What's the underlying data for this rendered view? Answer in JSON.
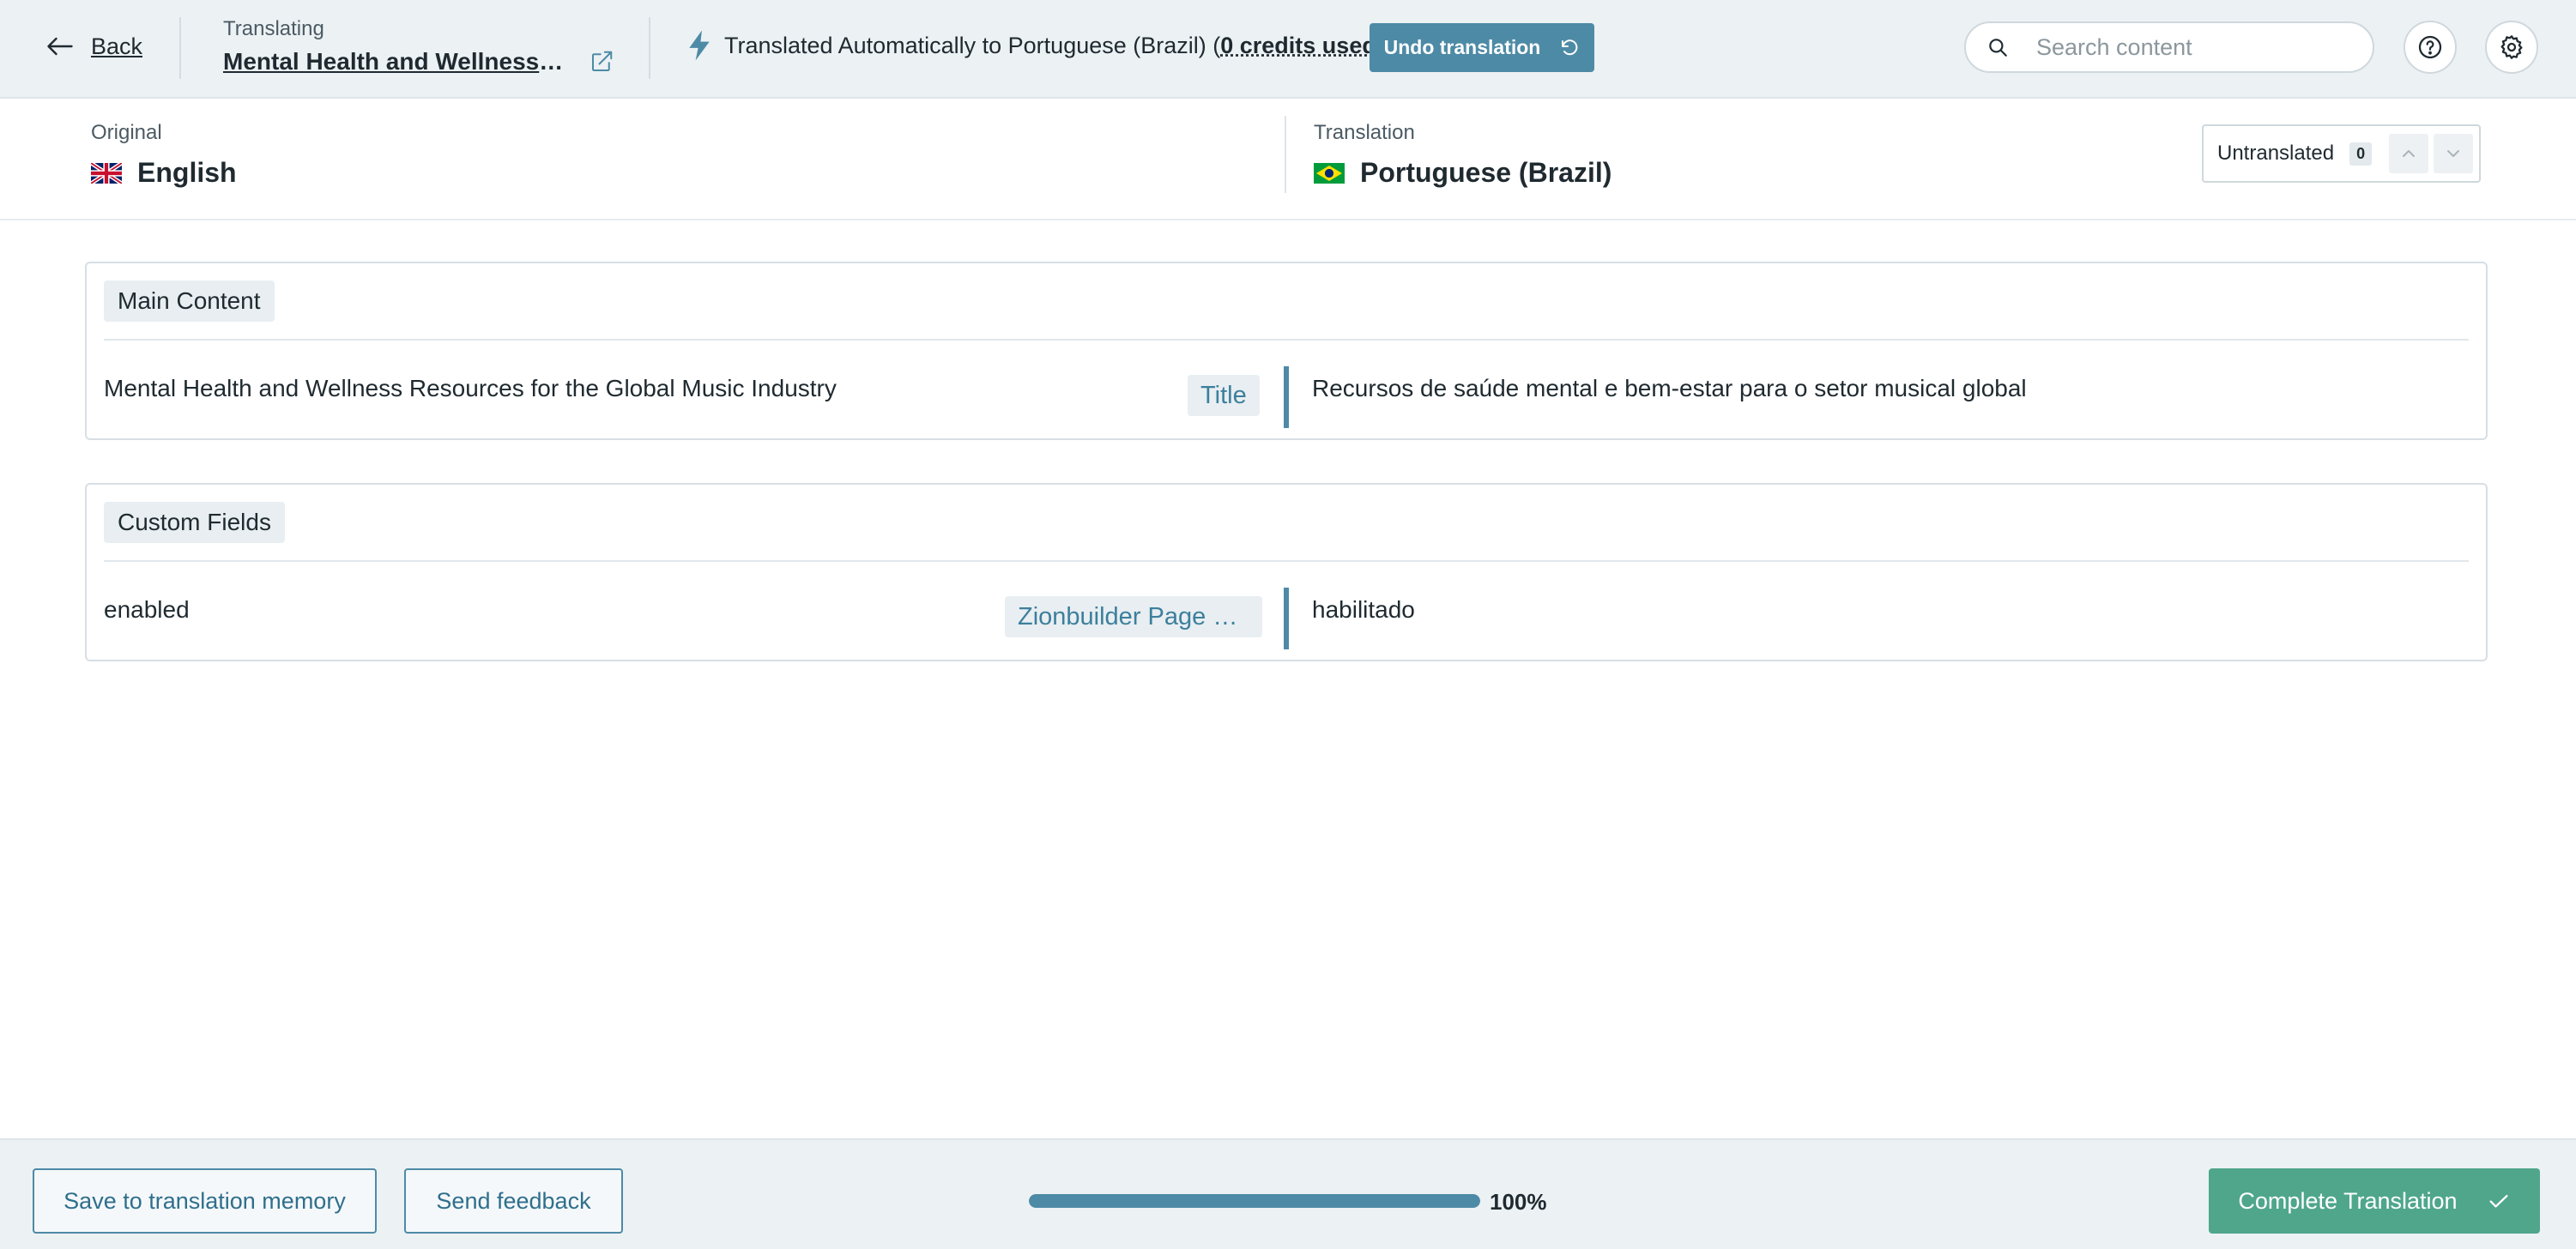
{
  "header": {
    "back_label": "Back",
    "translating_label": "Translating",
    "document_title": "Mental Health and Wellness Resources for the Global Music Industry",
    "auto_note_prefix": "Translated Automatically to Portuguese (Brazil) (",
    "credits_label": "0 credits used",
    "auto_note_suffix": ")",
    "undo_label": "Undo translation",
    "search_placeholder": "Search content",
    "icons": {
      "back": "arrow-left-icon",
      "external": "external-link-icon",
      "auto": "lightning-bolt-icon",
      "undo": "undo-icon",
      "search": "search-icon",
      "help": "help-circle-icon",
      "settings": "gear-icon"
    }
  },
  "languages": {
    "original_label": "Original",
    "original_name": "English",
    "original_flag": "uk-flag-icon",
    "translation_label": "Translation",
    "translation_name": "Portuguese (Brazil)",
    "translation_flag": "brazil-flag-icon",
    "untranslated_label": "Untranslated",
    "untranslated_count": "0"
  },
  "sections": [
    {
      "title": "Main Content",
      "rows": [
        {
          "original": "Mental Health and Wellness Resources for the Global Music Industry",
          "type": "Title",
          "translation": "Recursos de saúde mental e bem-estar para o setor musical global"
        }
      ]
    },
    {
      "title": "Custom Fields",
      "rows": [
        {
          "original": "enabled",
          "type": "Zionbuilder Page Status",
          "translation": "habilitado"
        }
      ]
    }
  ],
  "footer": {
    "save_memory_label": "Save to translation memory",
    "feedback_label": "Send feedback",
    "progress_percent": 100,
    "progress_text": "100%",
    "complete_label": "Complete Translation"
  },
  "colors": {
    "accent": "#4d8aa6",
    "complete": "#4fa68b",
    "topbar_bg": "#ecf1f4",
    "text": "#1f2a30"
  }
}
